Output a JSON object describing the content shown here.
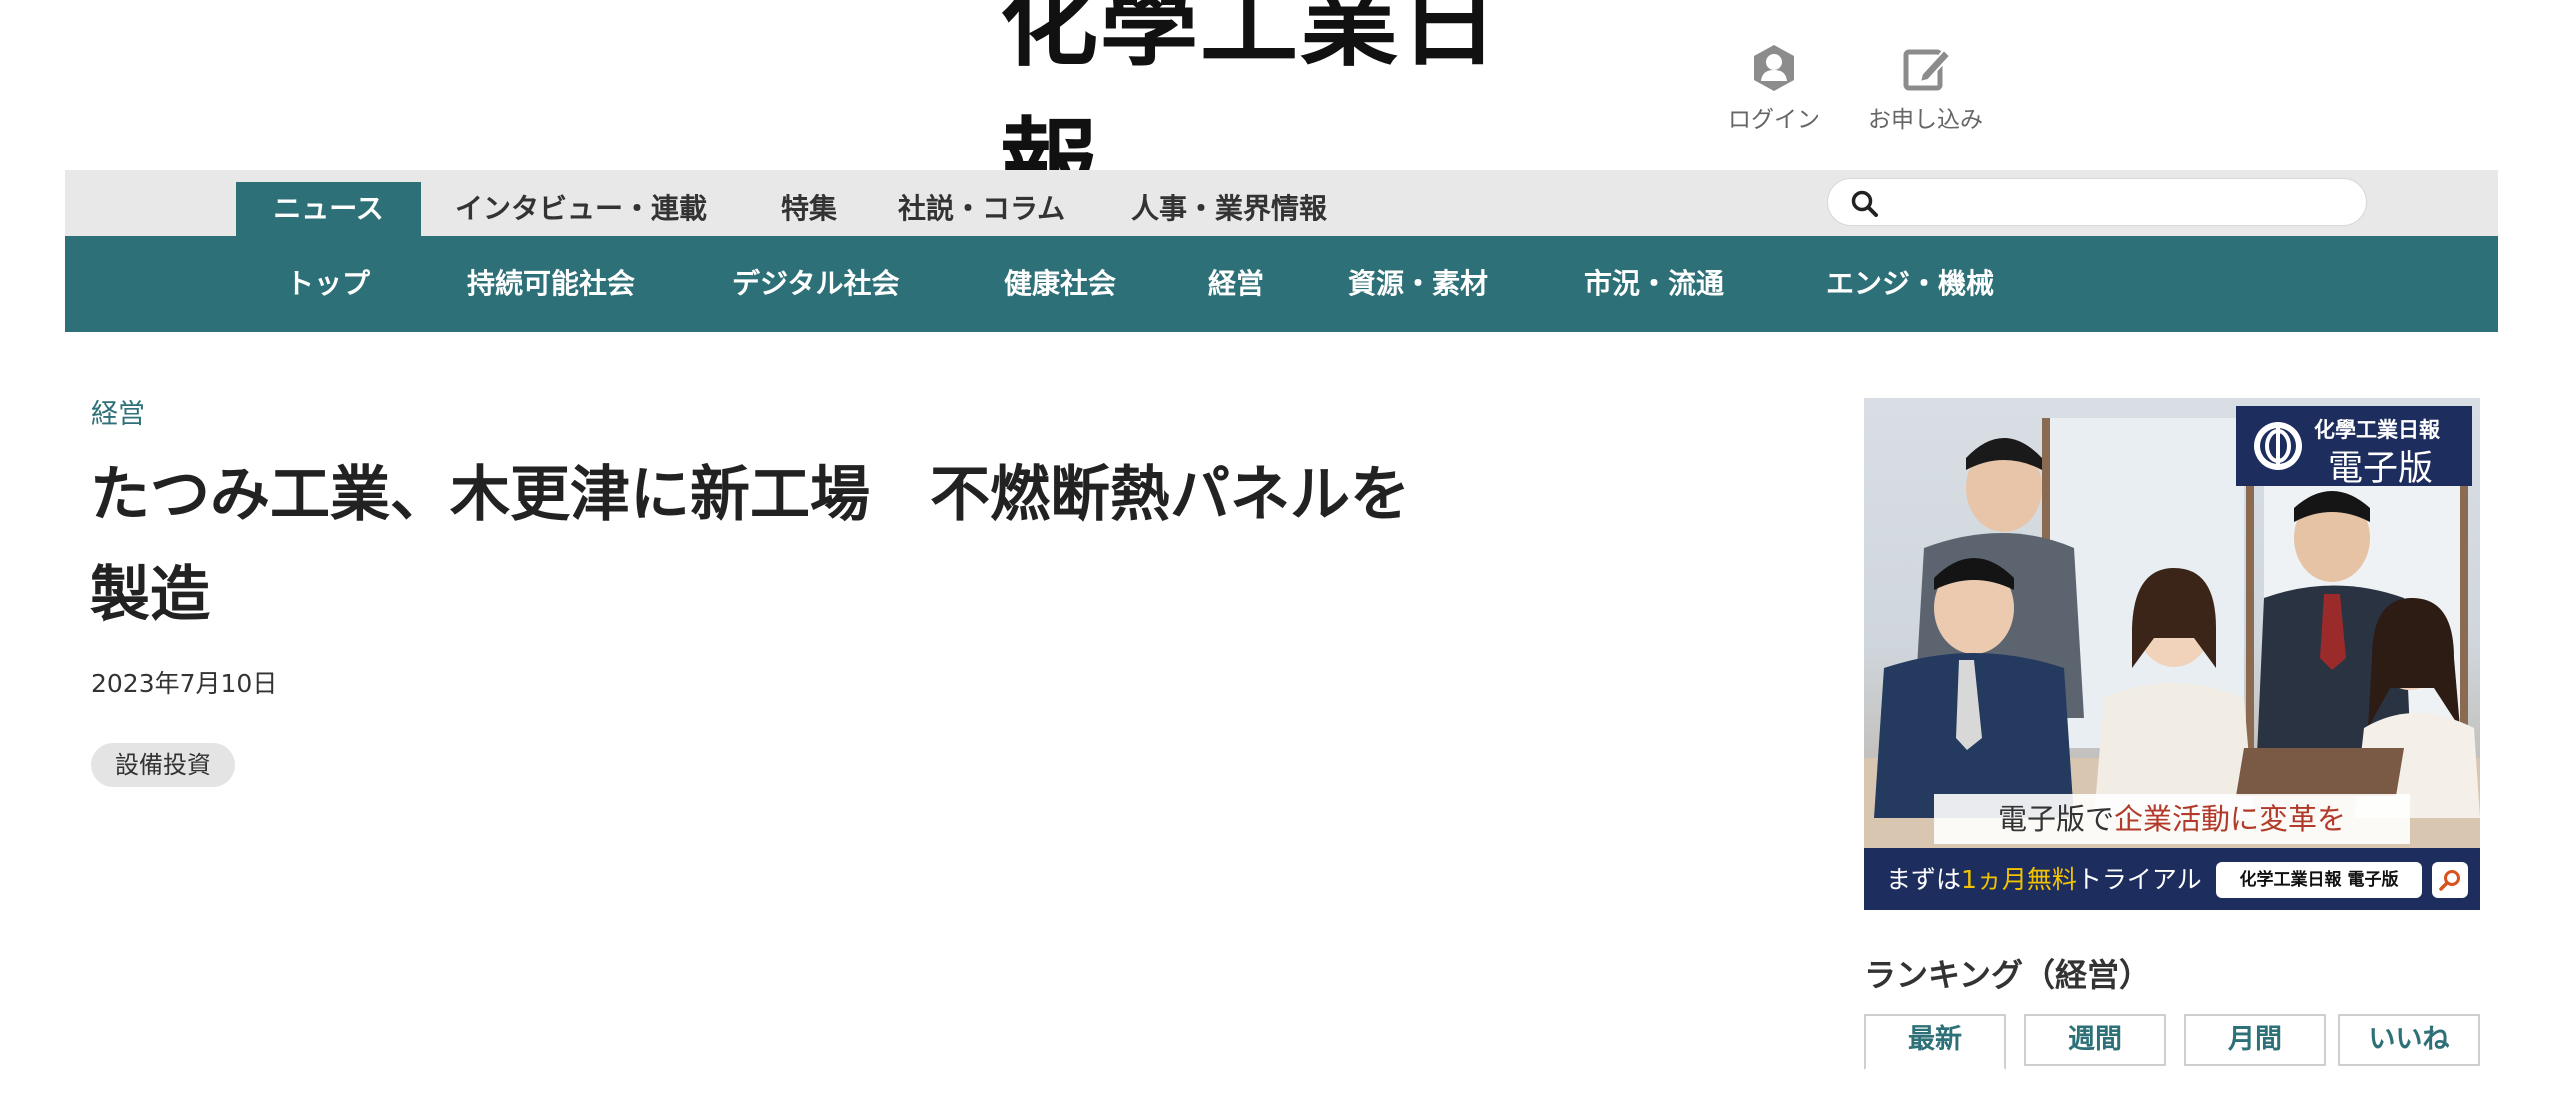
{
  "header": {
    "masthead": "化學工業日報",
    "login_label": "ログイン",
    "signup_label": "お申し込み"
  },
  "primary_tabs": [
    {
      "label": "ニュース",
      "active": true
    },
    {
      "label": "インタビュー・連載",
      "active": false
    },
    {
      "label": "特集",
      "active": false
    },
    {
      "label": "社説・コラム",
      "active": false
    },
    {
      "label": "人事・業界情報",
      "active": false
    }
  ],
  "search": {
    "placeholder": "",
    "value": ""
  },
  "subnav": [
    {
      "label": "トップ"
    },
    {
      "label": "持続可能社会"
    },
    {
      "label": "デジタル社会"
    },
    {
      "label": "健康社会"
    },
    {
      "label": "経営"
    },
    {
      "label": "資源・素材"
    },
    {
      "label": "市況・流通"
    },
    {
      "label": "エンジ・機械"
    }
  ],
  "article": {
    "category": "経営",
    "title": "たつみ工業、木更津に新工場　不燃断熱パネルを製造",
    "date": "2023年7月10日",
    "tags": [
      "設備投資"
    ]
  },
  "ad": {
    "brand_small": "化學工業日報",
    "brand_large": "電子版",
    "caption_prefix": "電子版で",
    "caption_highlight": "企業活動に変革を",
    "trial_prefix": "まずは",
    "trial_highlight": "1ヵ月無料",
    "trial_suffix": "トライアル",
    "pill_label": "化学工業日報 電子版"
  },
  "ranking": {
    "heading": "ランキング（経営）",
    "tabs": [
      {
        "label": "最新",
        "active": true
      },
      {
        "label": "週間",
        "active": false
      },
      {
        "label": "月間",
        "active": false
      },
      {
        "label": "いいね",
        "active": false
      }
    ]
  },
  "colors": {
    "accent_teal": "#2e7077",
    "navy": "#1c2d5e",
    "highlight_yellow": "#f2c200",
    "highlight_red": "#b23a2a"
  }
}
